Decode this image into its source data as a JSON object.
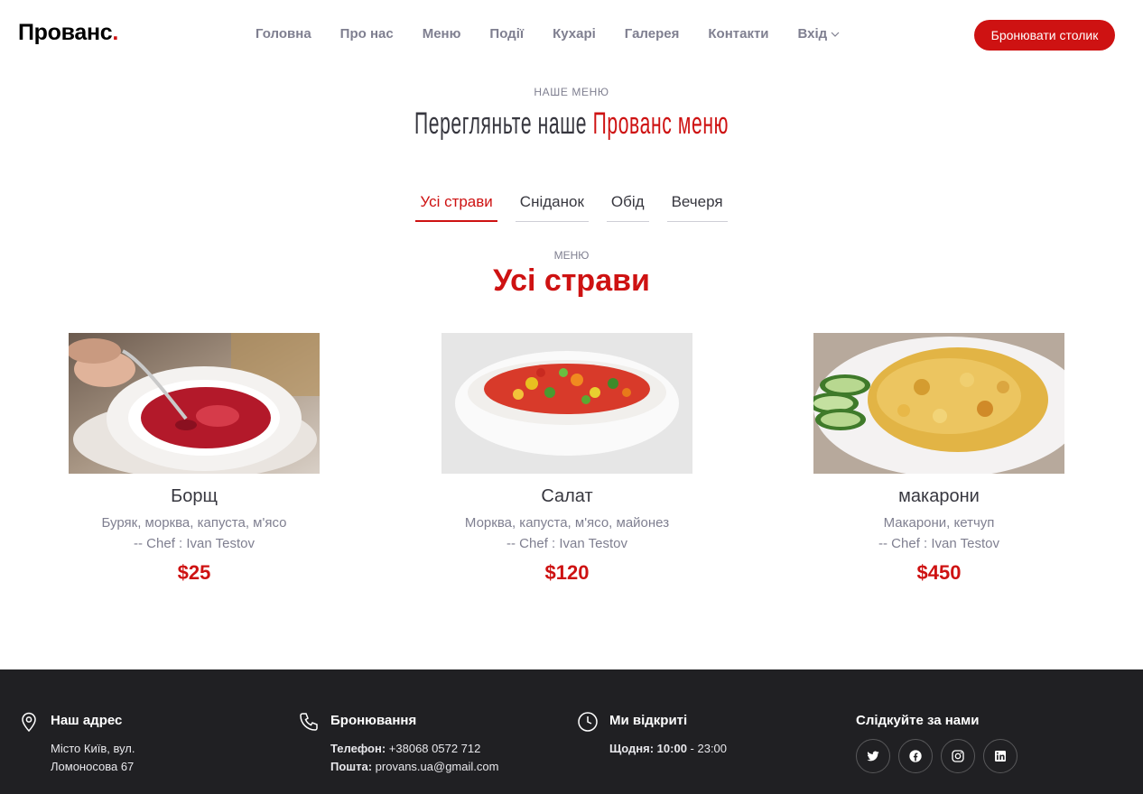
{
  "header": {
    "logo": "Прованс",
    "logo_dot": ".",
    "nav": [
      {
        "label": "Головна"
      },
      {
        "label": "Про нас"
      },
      {
        "label": "Меню"
      },
      {
        "label": "Події"
      },
      {
        "label": "Кухарі"
      },
      {
        "label": "Галерея"
      },
      {
        "label": "Контакти"
      },
      {
        "label": "Вхід",
        "icon": "chevron-down-icon"
      }
    ],
    "book_button": "Бронювати столик"
  },
  "menu_section": {
    "subtitle": "Наше меню",
    "title_main": "Перегляньте наше",
    "title_accent": "Прованс меню",
    "tabs": [
      {
        "label": "Усі страви",
        "active": true
      },
      {
        "label": "Сніданок",
        "active": false
      },
      {
        "label": "Обід",
        "active": false
      },
      {
        "label": "Вечеря",
        "active": false
      }
    ],
    "category_subtitle": "Меню",
    "category_title": "Усі страви",
    "items": [
      {
        "name": "Борщ",
        "ingredients": "Буряк, морква, капуста, м'ясо",
        "chef": "-- Chef : Ivan Testov",
        "price": "$25",
        "image": "borscht-photo"
      },
      {
        "name": "Салат",
        "ingredients": "Морква, капуста, м'ясо, майонез",
        "chef": "-- Chef : Ivan Testov",
        "price": "$120",
        "image": "salad-photo"
      },
      {
        "name": "макарони",
        "ingredients": "Макарони, кетчуп",
        "chef": "-- Chef : Ivan Testov",
        "price": "$450",
        "image": "pasta-photo"
      }
    ]
  },
  "footer": {
    "address": {
      "title": "Наш адрес",
      "line1": "Місто Київ, вул.",
      "line2": "Ломоносова 67",
      "icon": "map-pin-icon"
    },
    "booking": {
      "title": "Бронювання",
      "phone_label": "Телефон:",
      "phone": "+38068 0572 712",
      "email_label": "Пошта:",
      "email": "provans.ua@gmail.com",
      "icon": "phone-icon"
    },
    "hours": {
      "title": "Ми відкриті",
      "days_label": "Щодня:",
      "open": "10:00",
      "close": "- 23:00",
      "icon": "clock-icon"
    },
    "social": {
      "title": "Слідкуйте за нами",
      "icons": [
        "twitter-icon",
        "facebook-icon",
        "instagram-icon",
        "linkedin-icon"
      ]
    }
  },
  "colors": {
    "accent": "#ce1212",
    "text": "#37373f",
    "muted": "#7f7f90",
    "footer_bg": "#202023"
  }
}
